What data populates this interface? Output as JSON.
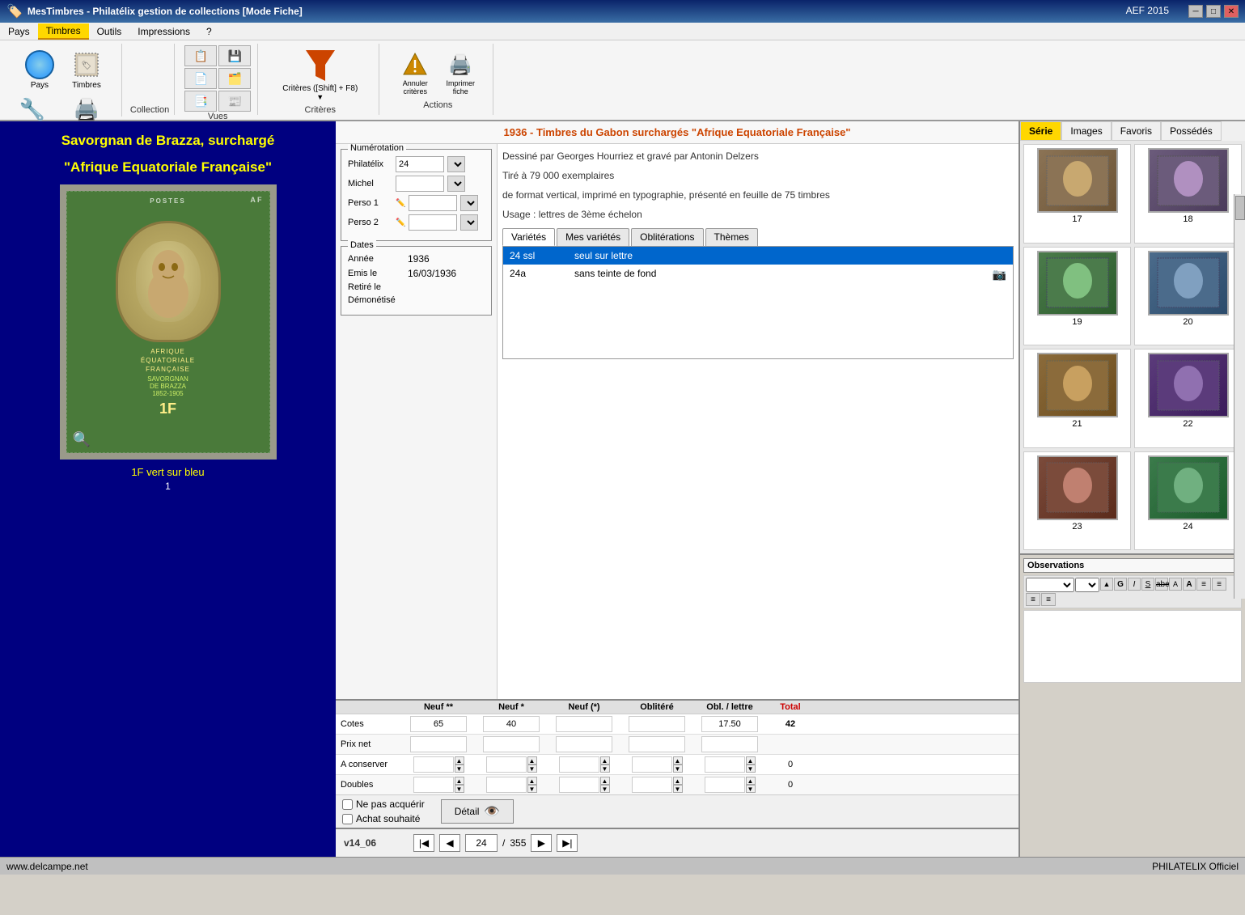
{
  "app": {
    "title": "MesTimbres - Philatélix gestion de collections [Mode Fiche]",
    "version_year": "AEF 2015"
  },
  "title_bar": {
    "title": "MesTimbres - Philatélix gestion de collections [Mode Fiche]",
    "version": "AEF 2015",
    "btn_minimize": "─",
    "btn_restore": "□",
    "btn_close": "✕"
  },
  "menu": {
    "items": [
      "Pays",
      "Timbres",
      "Outils",
      "Impressions",
      "?"
    ],
    "active": "Timbres"
  },
  "toolbar": {
    "groups": [
      {
        "name": "collection",
        "items": [
          {
            "id": "pays",
            "label": "Pays"
          },
          {
            "id": "timbres",
            "label": "Timbres"
          },
          {
            "id": "outils",
            "label": "Outils"
          },
          {
            "id": "impressions",
            "label": "Impressions"
          }
        ]
      },
      {
        "name": "collection-group-label",
        "label": "Collection"
      },
      {
        "name": "vues",
        "label": "Vues"
      },
      {
        "name": "criteres",
        "label": "Critères",
        "button": "Critères ([Shift] + F8)"
      },
      {
        "name": "actions",
        "label": "Actions",
        "items": [
          {
            "id": "annuler",
            "label": "Annuler\ncritères"
          },
          {
            "id": "imprimer",
            "label": "Imprimer\nfiche"
          }
        ]
      }
    ]
  },
  "series": {
    "title": "1936 - Timbres du Gabon surchargés \"Afrique Equatoriale Française\"",
    "designer": "Dessiné par Georges Hourriez et gravé par Antonin Delzers",
    "print_run": "Tiré à 79 000 exemplaires",
    "format": "de format vertical, imprimé en typographie, présenté en feuille de 75 timbres",
    "usage": "Usage : lettres de 3ème échelon"
  },
  "stamp": {
    "title_line1": "Savorgnan de Brazza, surchargé",
    "title_line2": "\"Afrique Equatoriale Française\"",
    "subtitle": "1F vert sur bleu",
    "number": "1"
  },
  "numerotation": {
    "label": "Numérotation",
    "philatelix_label": "Philatélix",
    "philatelix_value": "24",
    "michel_label": "Michel",
    "michel_value": "",
    "perso1_label": "Perso 1",
    "perso1_value": "",
    "perso2_label": "Perso 2",
    "perso2_value": ""
  },
  "dates": {
    "label": "Dates",
    "annee_label": "Année",
    "annee_value": "1936",
    "emis_label": "Emis le",
    "emis_value": "16/03/1936",
    "retire_label": "Retiré le",
    "retire_value": "",
    "demonetise_label": "Démonétisé",
    "demonetise_value": ""
  },
  "varieties": {
    "tabs": [
      "Variétés",
      "Mes variétés",
      "Oblitérations",
      "Thèmes"
    ],
    "active_tab": "Variétés",
    "rows": [
      {
        "code": "24 ssl",
        "description": "seul sur lettre",
        "selected": true
      },
      {
        "code": "24a",
        "description": "sans teinte de fond",
        "selected": false,
        "has_image": true
      }
    ]
  },
  "series_tabs": {
    "tabs": [
      "Série",
      "Images",
      "Favoris",
      "Possédés"
    ],
    "active": "Série"
  },
  "series_stamps": [
    {
      "number": "17",
      "thumb_class": "thumb-1"
    },
    {
      "number": "18",
      "thumb_class": "thumb-2"
    },
    {
      "number": "19",
      "thumb_class": "thumb-3"
    },
    {
      "number": "20",
      "thumb_class": "thumb-4"
    },
    {
      "number": "21",
      "thumb_class": "thumb-5"
    },
    {
      "number": "22",
      "thumb_class": "thumb-6"
    },
    {
      "number": "23",
      "thumb_class": "thumb-7"
    },
    {
      "number": "24",
      "thumb_class": "thumb-8"
    }
  ],
  "values": {
    "headers": [
      "",
      "Neuf **",
      "Neuf *",
      "Neuf (*)",
      "Oblitéré",
      "Obl. / lettre",
      "Total"
    ],
    "rows": [
      {
        "label": "Cotes",
        "neuf2": "65",
        "neuf1": "40",
        "neufp": "",
        "oblitere": "",
        "obl_lettre": "17.50",
        "total": "42"
      },
      {
        "label": "Prix net",
        "neuf2": "",
        "neuf1": "",
        "neufp": "",
        "oblitere": "",
        "obl_lettre": "",
        "total": ""
      },
      {
        "label": "A conserver",
        "neuf2": "",
        "neuf1": "",
        "neufp": "",
        "oblitere": "",
        "obl_lettre": "",
        "total": "0"
      },
      {
        "label": "Doubles",
        "neuf2": "",
        "neuf1": "",
        "neufp": "",
        "oblitere": "",
        "obl_lettre": "",
        "total": "0"
      }
    ]
  },
  "checkboxes": {
    "ne_pas": "Ne pas acquérir",
    "achat": "Achat souhaité"
  },
  "detail_btn": "Détail",
  "observations": {
    "label": "Observations"
  },
  "navigation": {
    "version": "v14_06",
    "current": "24",
    "total": "355"
  },
  "status_bar": {
    "left": "www.delcampe.net",
    "right": "PHILATELIX Officiel"
  }
}
